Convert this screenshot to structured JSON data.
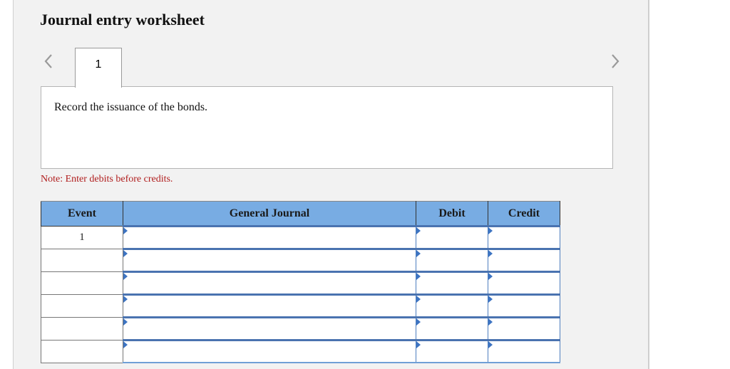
{
  "header": {
    "title": "Journal entry worksheet"
  },
  "navigation": {
    "prev_icon": "chevron-left-icon",
    "next_icon": "chevron-right-icon",
    "tabs": [
      {
        "label": "1",
        "active": true
      }
    ]
  },
  "instruction": {
    "text": "Record the issuance of the bonds."
  },
  "note": {
    "text": "Note: Enter debits before credits.",
    "color": "#b01c1c"
  },
  "journal_table": {
    "header_color": "#78ace3",
    "columns": [
      "Event",
      "General Journal",
      "Debit",
      "Credit"
    ],
    "rows": [
      {
        "event": "1",
        "account": "",
        "debit": "",
        "credit": ""
      },
      {
        "event": "",
        "account": "",
        "debit": "",
        "credit": ""
      },
      {
        "event": "",
        "account": "",
        "debit": "",
        "credit": ""
      },
      {
        "event": "",
        "account": "",
        "debit": "",
        "credit": ""
      },
      {
        "event": "",
        "account": "",
        "debit": "",
        "credit": ""
      },
      {
        "event": "",
        "account": "",
        "debit": "",
        "credit": ""
      }
    ]
  }
}
